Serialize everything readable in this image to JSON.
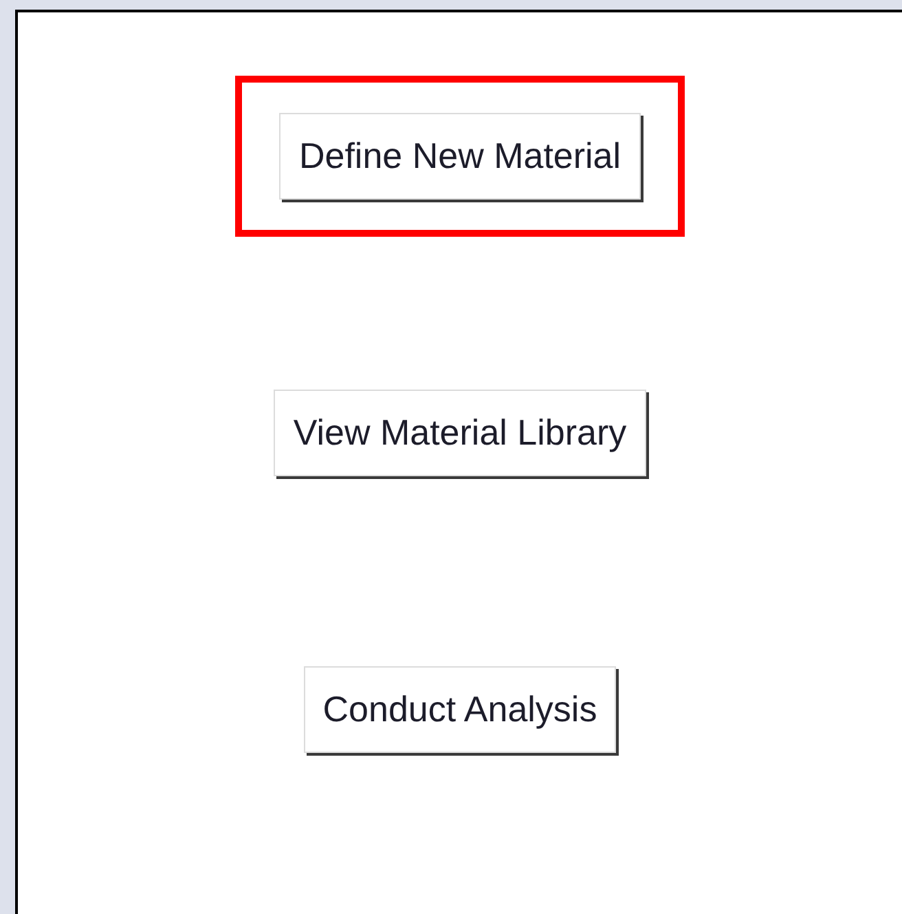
{
  "buttons": [
    {
      "label": "Define New Material",
      "highlighted": true
    },
    {
      "label": "View Material Library",
      "highlighted": false
    },
    {
      "label": "Conduct Analysis",
      "highlighted": false
    }
  ]
}
